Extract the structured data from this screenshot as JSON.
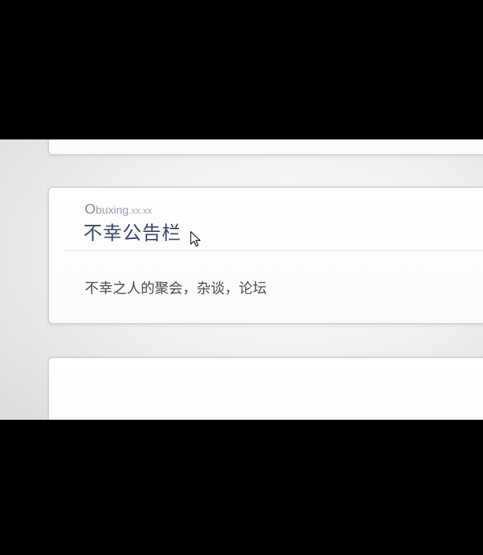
{
  "forum_card": {
    "domain_initial": "O",
    "domain_name": "buxing",
    "domain_suffix": ".xx.xx",
    "title": "不幸公告栏",
    "description": "不幸之人的聚会，杂谈，论坛"
  },
  "icons": {
    "cursor": "mouse-pointer-icon"
  },
  "colors": {
    "title": "#3b4675",
    "domain": "#8d8fa3",
    "card_border": "#d2d2d2",
    "letterbox": "#000000"
  }
}
